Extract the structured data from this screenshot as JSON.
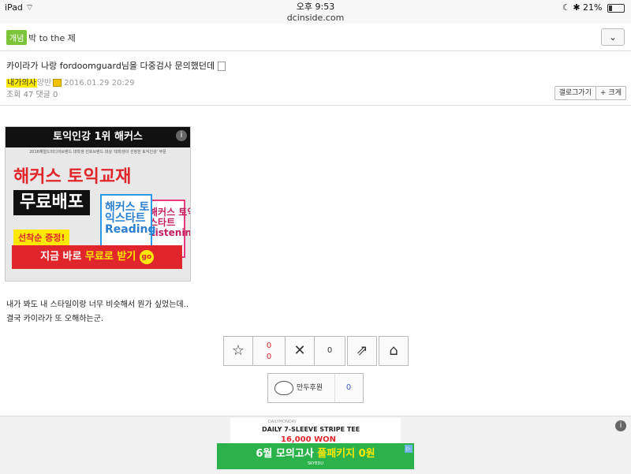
{
  "status_bar": {
    "device": "iPad",
    "time": "오후 9:53",
    "url": "dcinside.com",
    "battery": "21%",
    "battery_level": 0.21
  },
  "gallery": {
    "badge": "개념",
    "name": "박 to the 제",
    "dropdown_icon": "chevron-down-icon"
  },
  "post": {
    "title": "카이라가 나랑 fordoomguard님을 다중검사 문의했던데",
    "nickname": "내가의사",
    "nickname_extra": "양반",
    "date": "2016.01.29 20:29",
    "counts": "조회 47 댓글 0",
    "list_button": "갤로그가기",
    "zoom_button": "+ 크게",
    "body_lines": [
      "내가 봐도 내 스타일이랑 너무 비슷해서 뭔가 싶었는데..",
      "결국 카이라가 또 오해하는군."
    ]
  },
  "ad1": {
    "top": "토익인강 1위 해커스",
    "sub": "2016해럴드미디어브랜드 대학생 선호브랜드 대상 '대학생이 선정한 토익인강' 부문",
    "headline1": "해커스 토익교재",
    "headline2": "무료배포",
    "book1": "해커스 토익스타트 Reading",
    "book2": "해커스 토익스타트 Listening",
    "badge": "선착순 증정!",
    "cta_prefix": "지금 바로 ",
    "cta_strong": "무료로 받기",
    "cta_go": "go",
    "info": "i"
  },
  "actions": {
    "recommend_count": "0",
    "recommend_sub": "0",
    "not_recommend_count": "0",
    "donate_label": "만두후원",
    "donate_count": "0"
  },
  "ad2": {
    "daily": "DAILYMONDAY",
    "title": "DAILY 7-SLEEVE STRIPE TEE",
    "price": "16,000 WON",
    "banner_prefix": "6월 모의고사 ",
    "banner_accent": "풀패키지 0원",
    "banner_sub": "SKYEDU",
    "info": "i"
  }
}
